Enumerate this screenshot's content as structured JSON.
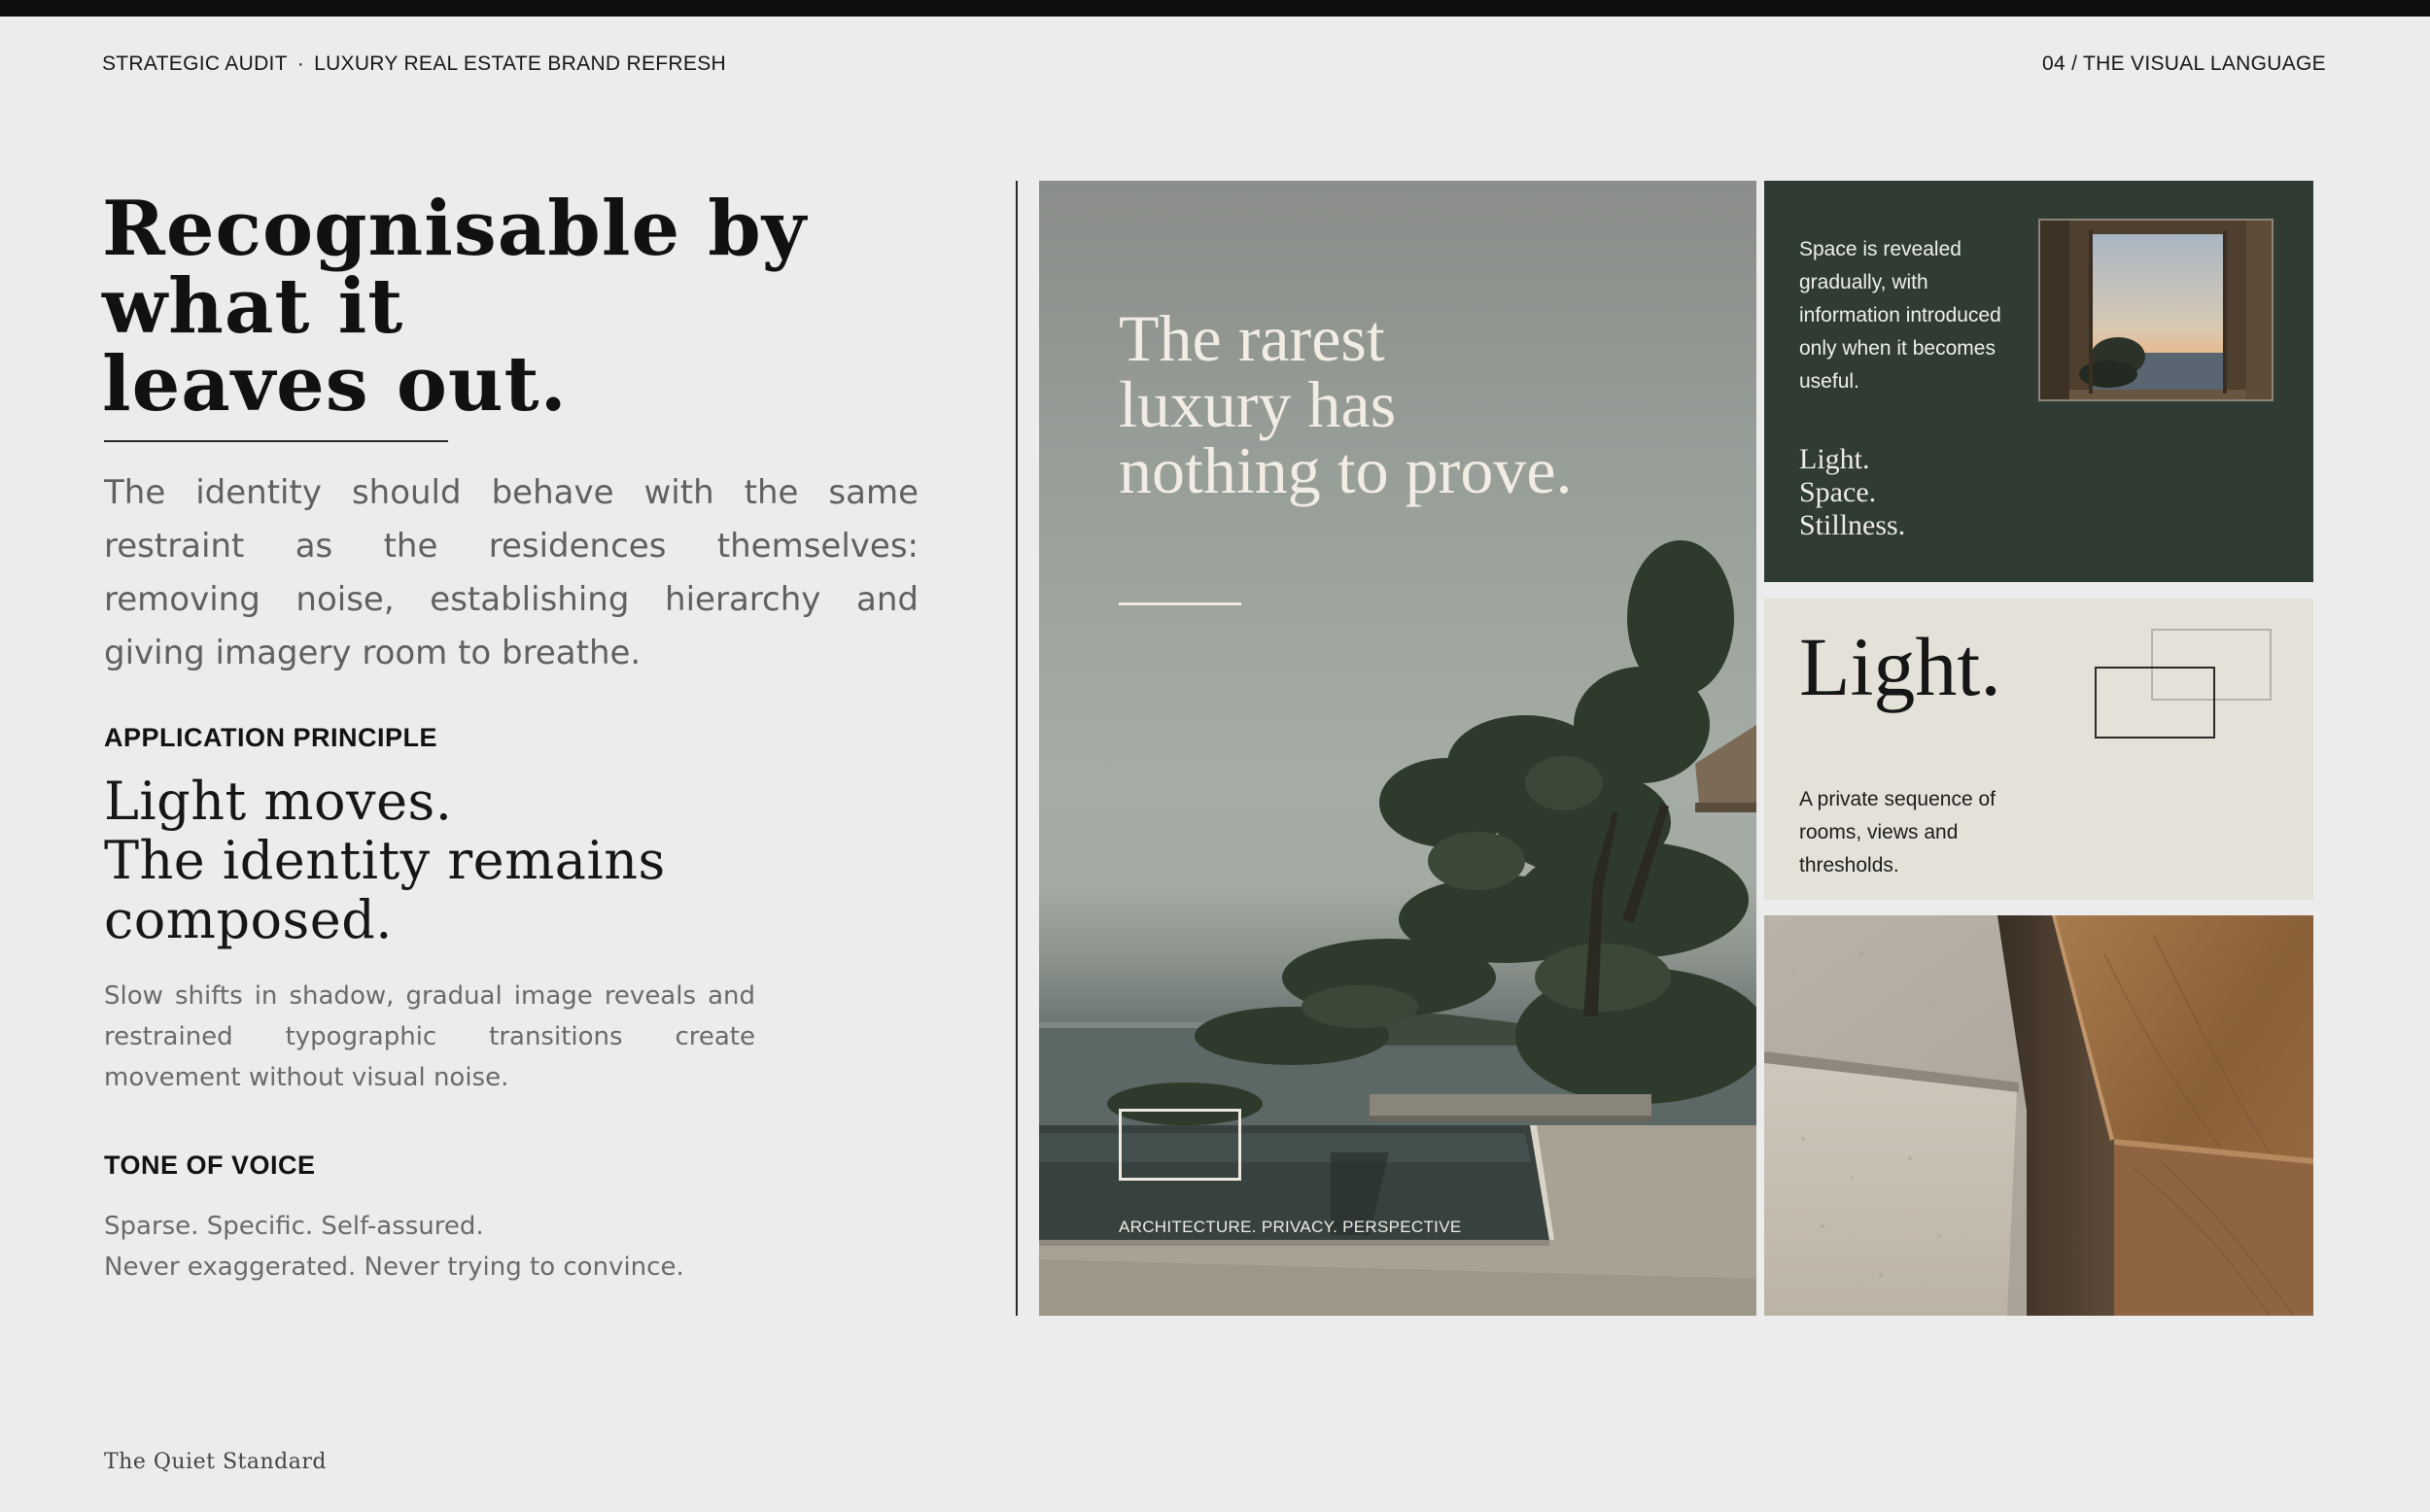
{
  "header": {
    "left_title": "STRATEGIC AUDIT",
    "separator": "·",
    "left_subtitle": "LUXURY REAL ESTATE BRAND REFRESH",
    "section": "04 / THE VISUAL LANGUAGE"
  },
  "headline": {
    "line1": "Recognisable by",
    "line2": "what it",
    "line3": "leaves out."
  },
  "intro": "The identity should behave with the same restraint as the residences themselves: removing noise, establishing hierarchy and giving imagery room to breathe.",
  "application": {
    "label": "APPLICATION PRINCIPLE",
    "line1": "Light moves.",
    "line2": "The identity remains",
    "line3": "composed.",
    "body": "Slow shifts in shadow, gradual image reveals and restrained typographic transitions create movement without visual noise."
  },
  "tone": {
    "label": "TONE OF VOICE",
    "line1": "Sparse. Specific. Self-assured.",
    "line2": "Never exaggerated. Never trying to convince."
  },
  "footer": {
    "brand": "The Quiet Standard"
  },
  "main_image": {
    "quote_line1": "The rarest",
    "quote_line2": "luxury has",
    "quote_line3": "nothing to prove.",
    "caption": "ARCHITECTURE. PRIVACY. PERSPECTIVE"
  },
  "green_card": {
    "text": "Space is revealed gradually, with information introduced only when it becomes useful.",
    "triad1": "Light.",
    "triad2": "Space.",
    "triad3": "Stillness."
  },
  "beige_card": {
    "title": "Light.",
    "text": "A private sequence of rooms, views and thresholds."
  },
  "colors": {
    "background": "#ececec",
    "dark_green": "#2f3b33",
    "beige": "#e4e2d8",
    "ink": "#141414"
  }
}
